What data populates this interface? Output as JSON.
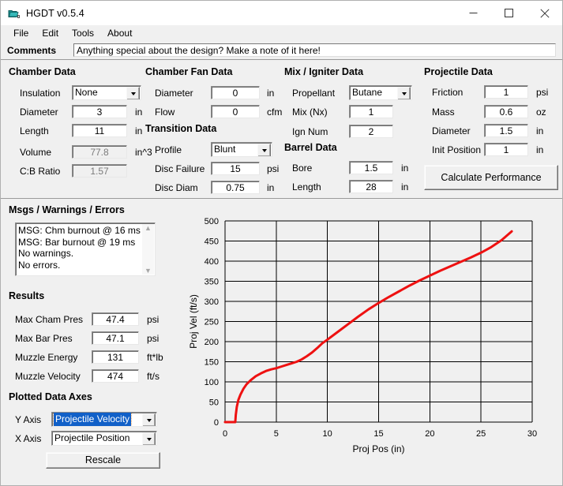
{
  "window": {
    "title": "HGDT v0.5.4",
    "icon": "app-folder-icon",
    "minimize": "–",
    "maximize": "□",
    "close": "✕"
  },
  "menu": {
    "items": [
      "File",
      "Edit",
      "Tools",
      "About"
    ]
  },
  "comments": {
    "label": "Comments",
    "value": "Anything special about the design?  Make a note of it here!",
    "placeholder": ""
  },
  "chamber_data": {
    "title": "Chamber Data",
    "rows": [
      {
        "label": "Insulation",
        "value": "None",
        "unit": "",
        "type": "combo"
      },
      {
        "label": "Diameter",
        "value": "3",
        "unit": "in",
        "type": "field"
      },
      {
        "label": "Length",
        "value": "11",
        "unit": "in",
        "type": "field"
      },
      {
        "label": "Volume",
        "value": "77.8",
        "unit": "in^3",
        "type": "readonly"
      },
      {
        "label": "C:B Ratio",
        "value": "1.57",
        "unit": "",
        "type": "readonly"
      }
    ]
  },
  "chamber_fan_data": {
    "title": "Chamber Fan Data",
    "rows": [
      {
        "label": "Diameter",
        "value": "0",
        "unit": "in",
        "type": "field"
      },
      {
        "label": "Flow",
        "value": "0",
        "unit": "cfm",
        "type": "field"
      }
    ]
  },
  "transition_data": {
    "title": "Transition Data",
    "rows": [
      {
        "label": "Profile",
        "value": "Blunt",
        "unit": "",
        "type": "combo"
      },
      {
        "label": "Disc Failure",
        "value": "15",
        "unit": "psi",
        "type": "field"
      },
      {
        "label": "Disc Diam",
        "value": "0.75",
        "unit": "in",
        "type": "field"
      }
    ]
  },
  "mix_igniter_data": {
    "title": "Mix / Igniter Data",
    "rows": [
      {
        "label": "Propellant",
        "value": "Butane",
        "unit": "",
        "type": "combo"
      },
      {
        "label": "Mix (Nx)",
        "value": "1",
        "unit": "",
        "type": "field"
      },
      {
        "label": "Ign Num",
        "value": "2",
        "unit": "",
        "type": "field"
      }
    ]
  },
  "barrel_data": {
    "title": "Barrel Data",
    "rows": [
      {
        "label": "Bore",
        "value": "1.5",
        "unit": "in",
        "type": "field"
      },
      {
        "label": "Length",
        "value": "28",
        "unit": "in",
        "type": "field"
      }
    ]
  },
  "projectile_data": {
    "title": "Projectile Data",
    "rows": [
      {
        "label": "Friction",
        "value": "1",
        "unit": "psi",
        "type": "field"
      },
      {
        "label": "Mass",
        "value": "0.6",
        "unit": "oz",
        "type": "field"
      },
      {
        "label": "Diameter",
        "value": "1.5",
        "unit": "in",
        "type": "field"
      },
      {
        "label": "Init Position",
        "value": "1",
        "unit": "in",
        "type": "field"
      }
    ],
    "calculate_button": "Calculate Performance"
  },
  "messages": {
    "title": "Msgs / Warnings / Errors",
    "lines": [
      "MSG: Chm burnout @ 16 ms",
      "MSG: Bar burnout @ 19 ms",
      "No warnings.",
      "No errors."
    ],
    "scroll_up": "▲",
    "scroll_down": "▼"
  },
  "results": {
    "title": "Results",
    "rows": [
      {
        "label": "Max Cham Pres",
        "value": "47.4",
        "unit": "psi"
      },
      {
        "label": "Max Bar Pres",
        "value": "47.1",
        "unit": "psi"
      },
      {
        "label": "Muzzle Energy",
        "value": "131",
        "unit": "ft*lb"
      },
      {
        "label": "Muzzle Velocity",
        "value": "474",
        "unit": "ft/s"
      }
    ]
  },
  "plotted_data_axes": {
    "title": "Plotted Data Axes",
    "y_axis_label": "Y Axis",
    "y_axis_value": "Projectile Velocity",
    "x_axis_label": "X Axis",
    "x_axis_value": "Projectile Position",
    "rescale_button": "Rescale"
  },
  "chart_data": {
    "type": "line",
    "title": "",
    "xlabel": "Proj Pos (in)",
    "ylabel": "Proj Vel (ft/s)",
    "xlim": [
      0,
      30
    ],
    "ylim": [
      0,
      500
    ],
    "xticks": [
      0,
      5,
      10,
      15,
      20,
      25,
      30
    ],
    "yticks": [
      0,
      50,
      100,
      150,
      200,
      250,
      300,
      350,
      400,
      450,
      500
    ],
    "grid": true,
    "legend": null,
    "series": [
      {
        "name": "Projectile Velocity",
        "color": "#ee1111",
        "x": [
          0.0,
          0.5,
          1.0,
          1.05,
          1.15,
          1.3,
          1.5,
          1.8,
          2.1,
          2.5,
          3.0,
          3.5,
          4.0,
          4.5,
          5.0,
          5.5,
          6.0,
          6.5,
          7.0,
          7.5,
          8.0,
          8.5,
          9.0,
          9.5,
          10.0,
          11.0,
          12.0,
          13.0,
          14.0,
          15.0,
          16.0,
          17.0,
          18.0,
          19.0,
          20.0,
          21.0,
          22.0,
          23.0,
          24.0,
          25.0,
          26.0,
          27.0,
          28.0
        ],
        "y": [
          0,
          0,
          0,
          18,
          38,
          55,
          68,
          83,
          94,
          104,
          114,
          121,
          127,
          131,
          134,
          138,
          142,
          146,
          150,
          156,
          164,
          173,
          184,
          196,
          205,
          224,
          243,
          262,
          280,
          296,
          311,
          325,
          339,
          352,
          364,
          376,
          387,
          398,
          409,
          421,
          435,
          452,
          474
        ]
      }
    ]
  }
}
